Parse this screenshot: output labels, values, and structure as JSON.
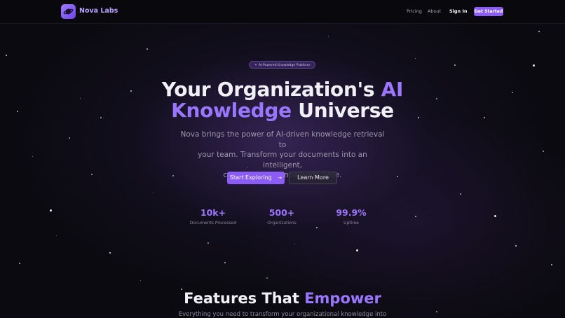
{
  "nav": {
    "brand": "Nova Labs",
    "links": [
      "Pricing",
      "About"
    ],
    "sign_in": "Sign In",
    "cta": "Get Started",
    "logo_icon": "planet-icon"
  },
  "hero": {
    "badge": "AI-Powered Knowledge Platform",
    "badge_icon": "sparkle-icon",
    "title_line1_a": "Your Organization's ",
    "title_line1_b": "AI",
    "title_line2_a": "Knowledge",
    "title_line2_b": " Universe",
    "subtitle_line1": "Nova brings the power of AI-driven knowledge retrieval to",
    "subtitle_line2": "your team. Transform your documents into an intelligent,",
    "subtitle_line3": "conversational knowledge base.",
    "primary_button": "Start Exploring",
    "primary_button_icon": "arrow-right-icon",
    "secondary_button": "Learn More"
  },
  "stats": [
    {
      "value": "10k+",
      "label": "Documents Processed"
    },
    {
      "value": "500+",
      "label": "Organizations"
    },
    {
      "value": "99.9%",
      "label": "Uptime"
    }
  ],
  "features": {
    "title_a": "Features That ",
    "title_b": "Empower",
    "subtitle": "Everything you need to transform your organizational knowledge into"
  },
  "colors": {
    "accent": "#8b5cf6",
    "accent_text": "#9a76ff",
    "background": "#0b0a10"
  }
}
